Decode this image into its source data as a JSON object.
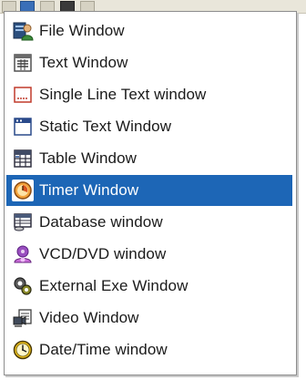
{
  "menu": {
    "items": [
      {
        "label": "File Window",
        "icon": "file-window-icon"
      },
      {
        "label": "Text Window",
        "icon": "text-window-icon"
      },
      {
        "label": "Single Line Text window",
        "icon": "single-line-text-icon"
      },
      {
        "label": "Static Text Window",
        "icon": "static-text-icon"
      },
      {
        "label": "Table Window",
        "icon": "table-window-icon"
      },
      {
        "label": "Timer Window",
        "icon": "timer-icon",
        "selected": true
      },
      {
        "label": "Database window",
        "icon": "database-icon"
      },
      {
        "label": "VCD/DVD window",
        "icon": "vcd-dvd-icon"
      },
      {
        "label": "External Exe Window",
        "icon": "external-exe-icon"
      },
      {
        "label": "Video Window",
        "icon": "video-window-icon"
      },
      {
        "label": "Date/Time window",
        "icon": "clock-icon"
      }
    ]
  },
  "colors": {
    "selection": "#1d66b6",
    "menu_border": "#8d8d8d"
  }
}
